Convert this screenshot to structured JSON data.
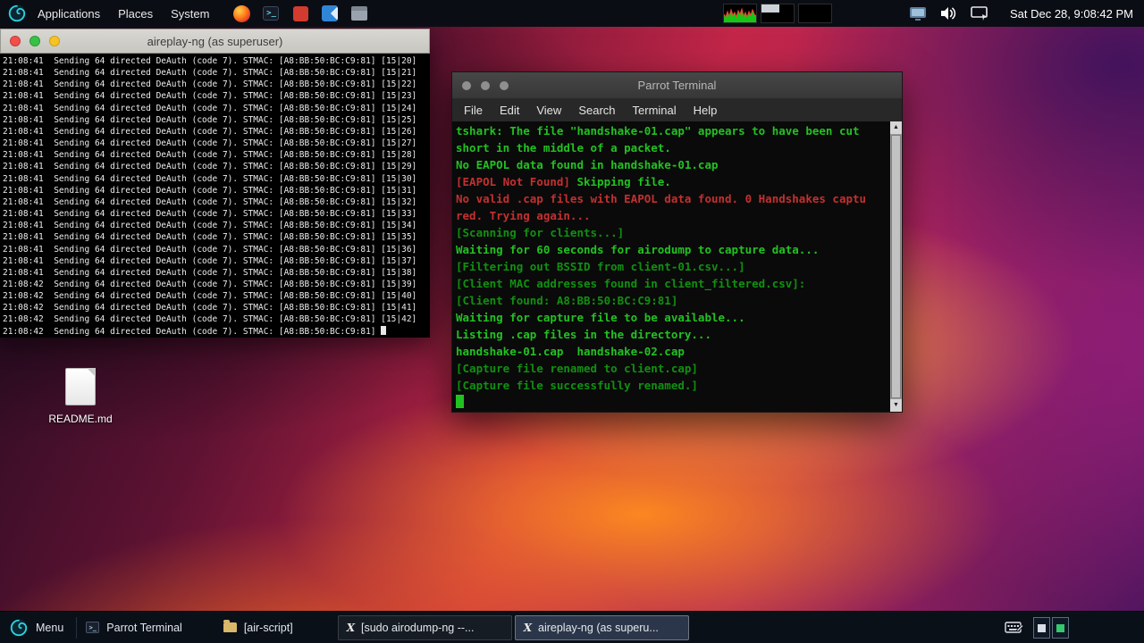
{
  "colors": {
    "term_green": "#22c122",
    "term_dim_green": "#119011",
    "term_red": "#c33030",
    "accent_cyan": "#29d3e2"
  },
  "top_panel": {
    "menus": [
      {
        "label": "Applications"
      },
      {
        "label": "Places"
      },
      {
        "label": "System"
      }
    ],
    "launchers": [
      "browser-icon",
      "terminal-launcher-icon",
      "screen-recorder-icon",
      "vscode-icon",
      "file-manager-icon"
    ],
    "monitors": [
      "cpu-graph",
      "memory-graph",
      "network-graph"
    ],
    "tray": [
      "display-settings-icon",
      "volume-icon",
      "screen-share-icon"
    ],
    "clock": "Sat Dec 28, 9:08:42 PM"
  },
  "aireplay_window": {
    "title": "aireplay-ng (as superuser)",
    "lines": [
      "21:08:41  Sending 64 directed DeAuth (code 7). STMAC: [A8:BB:50:BC:C9:81] [15|20]",
      "21:08:41  Sending 64 directed DeAuth (code 7). STMAC: [A8:BB:50:BC:C9:81] [15|21]",
      "21:08:41  Sending 64 directed DeAuth (code 7). STMAC: [A8:BB:50:BC:C9:81] [15|22]",
      "21:08:41  Sending 64 directed DeAuth (code 7). STMAC: [A8:BB:50:BC:C9:81] [15|23]",
      "21:08:41  Sending 64 directed DeAuth (code 7). STMAC: [A8:BB:50:BC:C9:81] [15|24]",
      "21:08:41  Sending 64 directed DeAuth (code 7). STMAC: [A8:BB:50:BC:C9:81] [15|25]",
      "21:08:41  Sending 64 directed DeAuth (code 7). STMAC: [A8:BB:50:BC:C9:81] [15|26]",
      "21:08:41  Sending 64 directed DeAuth (code 7). STMAC: [A8:BB:50:BC:C9:81] [15|27]",
      "21:08:41  Sending 64 directed DeAuth (code 7). STMAC: [A8:BB:50:BC:C9:81] [15|28]",
      "21:08:41  Sending 64 directed DeAuth (code 7). STMAC: [A8:BB:50:BC:C9:81] [15|29]",
      "21:08:41  Sending 64 directed DeAuth (code 7). STMAC: [A8:BB:50:BC:C9:81] [15|30]",
      "21:08:41  Sending 64 directed DeAuth (code 7). STMAC: [A8:BB:50:BC:C9:81] [15|31]",
      "21:08:41  Sending 64 directed DeAuth (code 7). STMAC: [A8:BB:50:BC:C9:81] [15|32]",
      "21:08:41  Sending 64 directed DeAuth (code 7). STMAC: [A8:BB:50:BC:C9:81] [15|33]",
      "21:08:41  Sending 64 directed DeAuth (code 7). STMAC: [A8:BB:50:BC:C9:81] [15|34]",
      "21:08:41  Sending 64 directed DeAuth (code 7). STMAC: [A8:BB:50:BC:C9:81] [15|35]",
      "21:08:41  Sending 64 directed DeAuth (code 7). STMAC: [A8:BB:50:BC:C9:81] [15|36]",
      "21:08:41  Sending 64 directed DeAuth (code 7). STMAC: [A8:BB:50:BC:C9:81] [15|37]",
      "21:08:41  Sending 64 directed DeAuth (code 7). STMAC: [A8:BB:50:BC:C9:81] [15|38]",
      "21:08:42  Sending 64 directed DeAuth (code 7). STMAC: [A8:BB:50:BC:C9:81] [15|39]",
      "21:08:42  Sending 64 directed DeAuth (code 7). STMAC: [A8:BB:50:BC:C9:81] [15|40]",
      "21:08:42  Sending 64 directed DeAuth (code 7). STMAC: [A8:BB:50:BC:C9:81] [15|41]",
      "21:08:42  Sending 64 directed DeAuth (code 7). STMAC: [A8:BB:50:BC:C9:81] [15|42]"
    ],
    "cursor_line": "21:08:42  Sending 64 directed DeAuth (code 7). STMAC: [A8:BB:50:BC:C9:81] "
  },
  "desktop": {
    "readme_label": "README.md"
  },
  "parrot_terminal": {
    "title": "Parrot Terminal",
    "menu": [
      "File",
      "Edit",
      "View",
      "Search",
      "Terminal",
      "Help"
    ],
    "output": [
      [
        {
          "t": "tshark: The file \"handshake-01.cap\" appears to have been cut",
          "c": "g"
        }
      ],
      [
        {
          "t": "short in the middle of a packet.",
          "c": "g"
        }
      ],
      [
        {
          "t": "No EAPOL data found in handshake-01.cap",
          "c": "g"
        }
      ],
      [
        {
          "t": "[EAPOL Not Found]",
          "c": "r"
        },
        {
          "t": " Skipping file.",
          "c": "g"
        }
      ],
      [
        {
          "t": "No valid .cap files with EAPOL data found. 0 Handshakes captu",
          "c": "r"
        }
      ],
      [
        {
          "t": "red. Trying again...",
          "c": "r"
        }
      ],
      [
        {
          "t": "[Scanning for clients...]",
          "c": "d"
        }
      ],
      [
        {
          "t": "Waiting for 60 seconds for airodump to capture data...",
          "c": "g"
        }
      ],
      [
        {
          "t": "[Filtering out BSSID from client-01.csv...]",
          "c": "d"
        }
      ],
      [
        {
          "t": "[Client MAC addresses found in client_filtered.csv]:",
          "c": "d"
        }
      ],
      [
        {
          "t": "[Client found: A8:BB:50:BC:C9:81]",
          "c": "d"
        }
      ],
      [
        {
          "t": "Waiting for capture file to be available...",
          "c": "g"
        }
      ],
      [
        {
          "t": "Listing .cap files in the directory...",
          "c": "g"
        }
      ],
      [
        {
          "t": "handshake-01.cap  handshake-02.cap",
          "c": "g"
        }
      ],
      [
        {
          "t": "[Capture file renamed to client.cap]",
          "c": "d"
        }
      ],
      [
        {
          "t": "[Capture file successfully renamed.]",
          "c": "d"
        }
      ]
    ]
  },
  "taskbar": {
    "menu_label": "Menu",
    "windows": [
      {
        "label": "Parrot Terminal",
        "icon": "terminal-icon",
        "active": false
      },
      {
        "label": "[air-script]",
        "icon": "folder-icon",
        "active": false
      },
      {
        "label": "[sudo airodump-ng --...",
        "icon": "xterm-icon",
        "active": false
      },
      {
        "label": "aireplay-ng (as superu...",
        "icon": "xterm-icon",
        "active": true
      }
    ]
  }
}
